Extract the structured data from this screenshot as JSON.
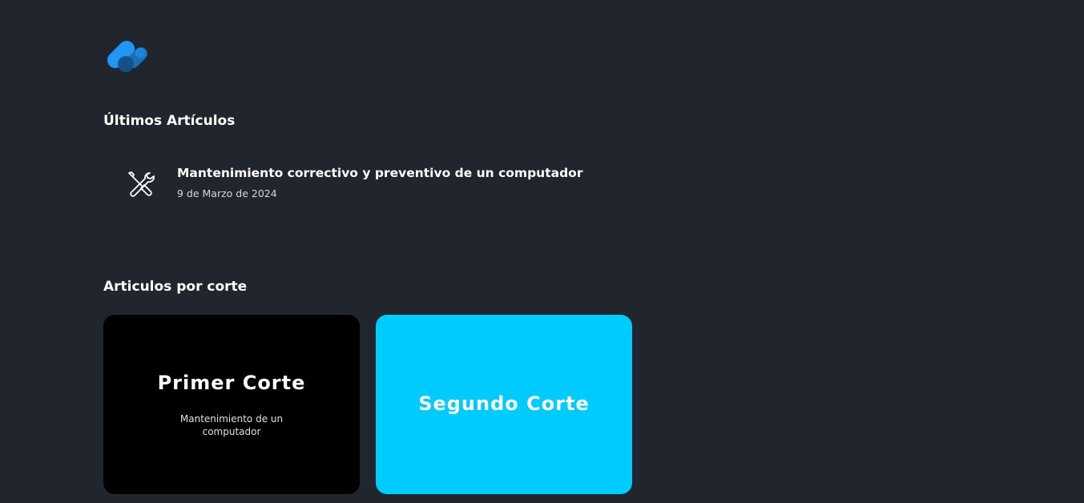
{
  "logo": {
    "icon": "capsule-logo-icon",
    "colors": [
      "#2196f3",
      "#1a6fb5",
      "#0d4f8c"
    ]
  },
  "latest": {
    "heading": "Últimos Artículos",
    "articles": [
      {
        "icon": "tools-icon",
        "title": "Mantenimiento correctivo y preventivo de un computador",
        "date": "9 de Marzo de 2024"
      }
    ]
  },
  "cuts": {
    "heading": "Articulos por corte",
    "cards": [
      {
        "title": "Primer Corte",
        "description": "Mantenimiento de un computador",
        "background": "#000000"
      },
      {
        "title": "Segundo Corte",
        "description": "",
        "background": "#00cbff"
      }
    ]
  },
  "colors": {
    "page_background": "#21252e",
    "text": "#ffffff",
    "muted_text": "#d6d8dc"
  }
}
